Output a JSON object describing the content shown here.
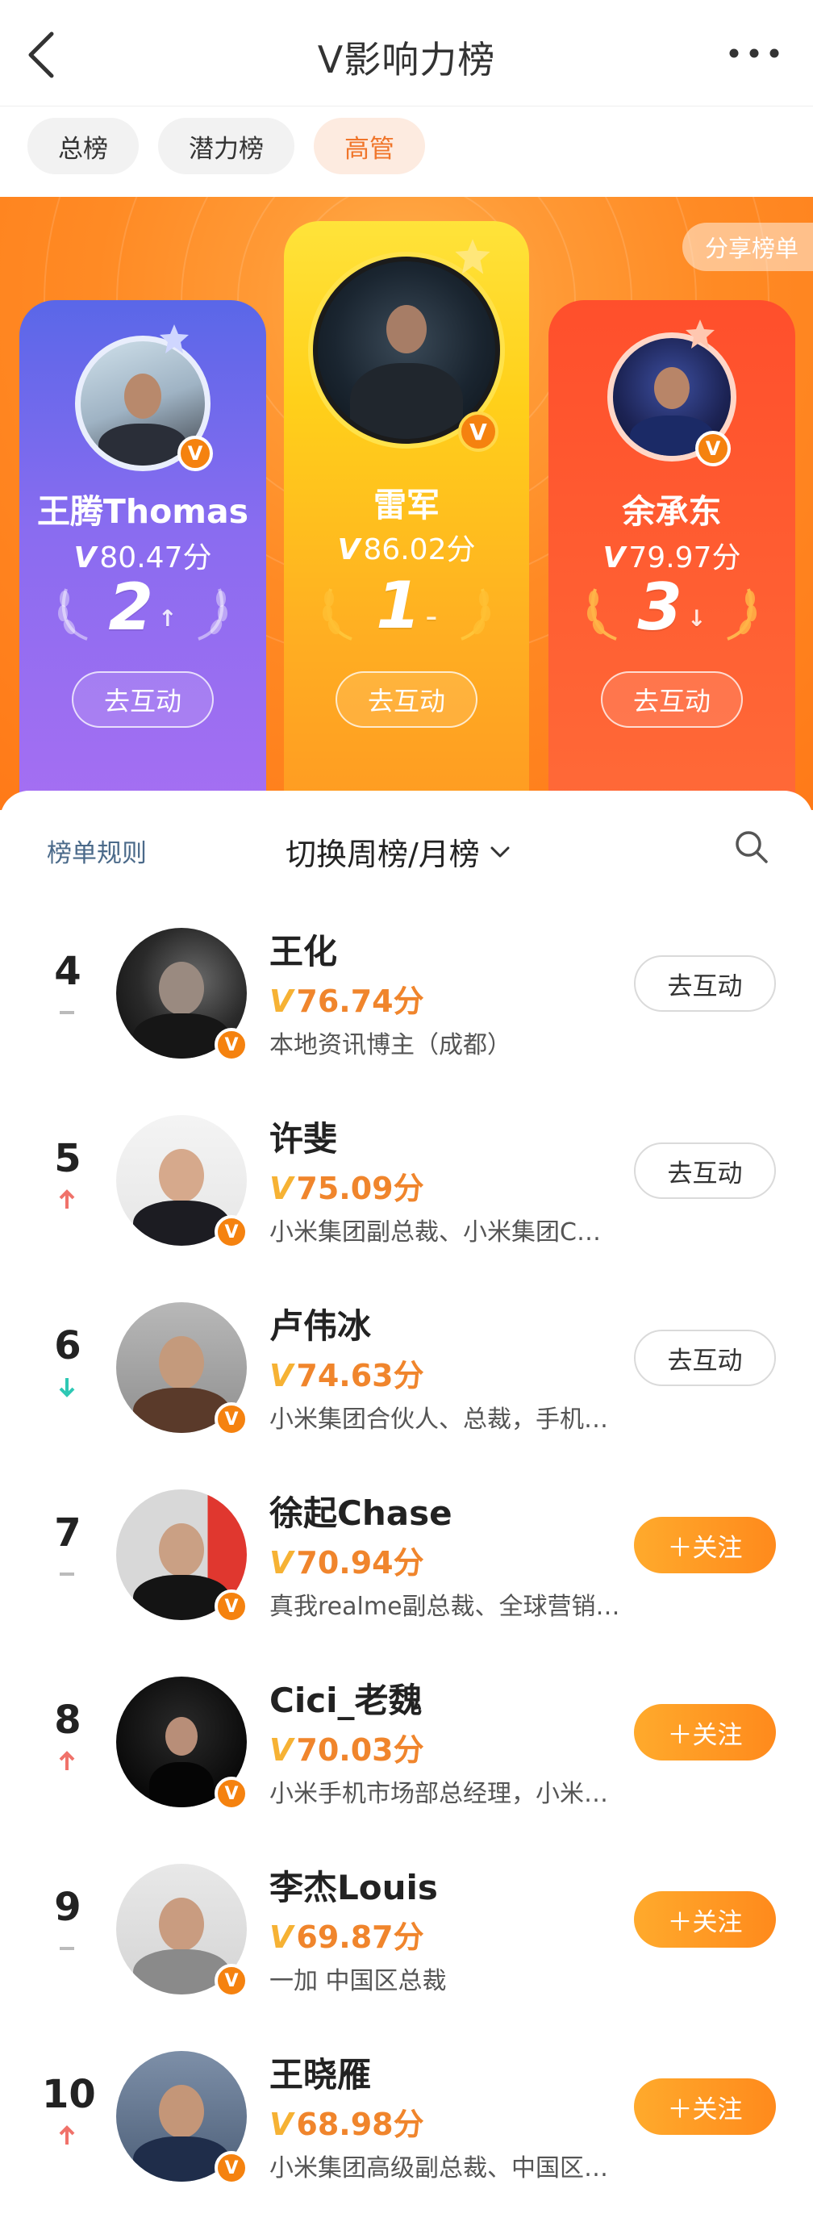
{
  "header": {
    "title": "V影响力榜"
  },
  "tabs": [
    {
      "label": "总榜"
    },
    {
      "label": "潜力榜"
    },
    {
      "label": "高管"
    }
  ],
  "share_label": "分享榜单",
  "top3": [
    {
      "name": "王腾Thomas",
      "vmark": "V",
      "score": "80.47分",
      "rank": "2",
      "trend": "↑",
      "action": "去互动"
    },
    {
      "name": "雷军",
      "vmark": "V",
      "score": "86.02分",
      "rank": "1",
      "trend": "–",
      "action": "去互动"
    },
    {
      "name": "余承东",
      "vmark": "V",
      "score": "79.97分",
      "rank": "3",
      "trend": "↓",
      "action": "去互动"
    }
  ],
  "panel": {
    "rules_label": "榜单规则",
    "switch_label": "切换周榜/月榜"
  },
  "list": [
    {
      "rank": "4",
      "trend": "same",
      "name": "王化",
      "vmark": "V",
      "score": "76.74分",
      "desc": "本地资讯博主（成都）",
      "action": "去互动",
      "action_type": "interact"
    },
    {
      "rank": "5",
      "trend": "up",
      "name": "许斐",
      "vmark": "V",
      "score": "75.09分",
      "desc": "小米集团副总裁、小米集团C…",
      "action": "去互动",
      "action_type": "interact"
    },
    {
      "rank": "6",
      "trend": "down",
      "name": "卢伟冰",
      "vmark": "V",
      "score": "74.63分",
      "desc": "小米集团合伙人、总裁，手机…",
      "action": "去互动",
      "action_type": "interact"
    },
    {
      "rank": "7",
      "trend": "same",
      "name": "徐起Chase",
      "vmark": "V",
      "score": "70.94分",
      "desc": "真我realme副总裁、全球营销…",
      "action": "＋关注",
      "action_type": "follow"
    },
    {
      "rank": "8",
      "trend": "up",
      "name": "Cici_老魏",
      "vmark": "V",
      "score": "70.03分",
      "desc": "小米手机市场部总经理，小米…",
      "action": "＋关注",
      "action_type": "follow"
    },
    {
      "rank": "9",
      "trend": "same",
      "name": "李杰Louis",
      "vmark": "V",
      "score": "69.87分",
      "desc": "一加 中国区总裁",
      "action": "＋关注",
      "action_type": "follow"
    },
    {
      "rank": "10",
      "trend": "up",
      "name": "王晓雁",
      "vmark": "V",
      "score": "68.98分",
      "desc": "小米集团高级副总裁、中国区…",
      "action": "＋关注",
      "action_type": "follow"
    }
  ],
  "colors": {
    "accent_orange": "#f0852c",
    "trend_up": "#f0726a",
    "trend_down": "#2ec8b4",
    "trend_same": "#bbbbbb"
  }
}
